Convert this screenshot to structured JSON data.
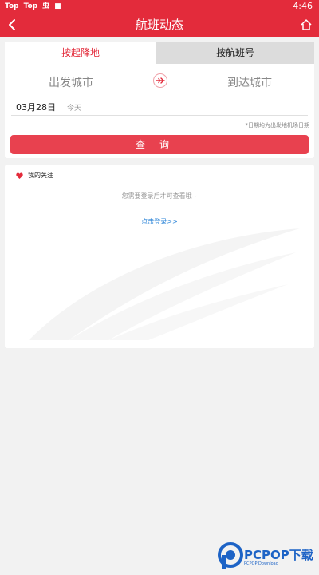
{
  "status_bar": {
    "icons": [
      "Top",
      "Top",
      "虫",
      "■"
    ],
    "time": "4:46"
  },
  "nav": {
    "title": "航班动态",
    "back_icon": "chevron-left-icon",
    "home_icon": "home-icon"
  },
  "tabs": [
    {
      "label": "按起降地",
      "active": true
    },
    {
      "label": "按航班号",
      "active": false
    }
  ],
  "search": {
    "from_placeholder": "出发城市",
    "to_placeholder": "到达城市",
    "date": "03月28日",
    "date_note": "今天",
    "hint": "*日期均为出发地机场日期",
    "query_label": "查询"
  },
  "favorites": {
    "title": "我的关注",
    "login_hint": "您需要登录后才可查看哦~",
    "login_link": "点击登录>>"
  },
  "watermark_brand": {
    "name": "PCPOP下载",
    "sub": "PCPOP Download"
  },
  "colors": {
    "brand_red": "#e32b3b",
    "button_red": "#e8414f",
    "link_blue": "#2e86d8"
  }
}
